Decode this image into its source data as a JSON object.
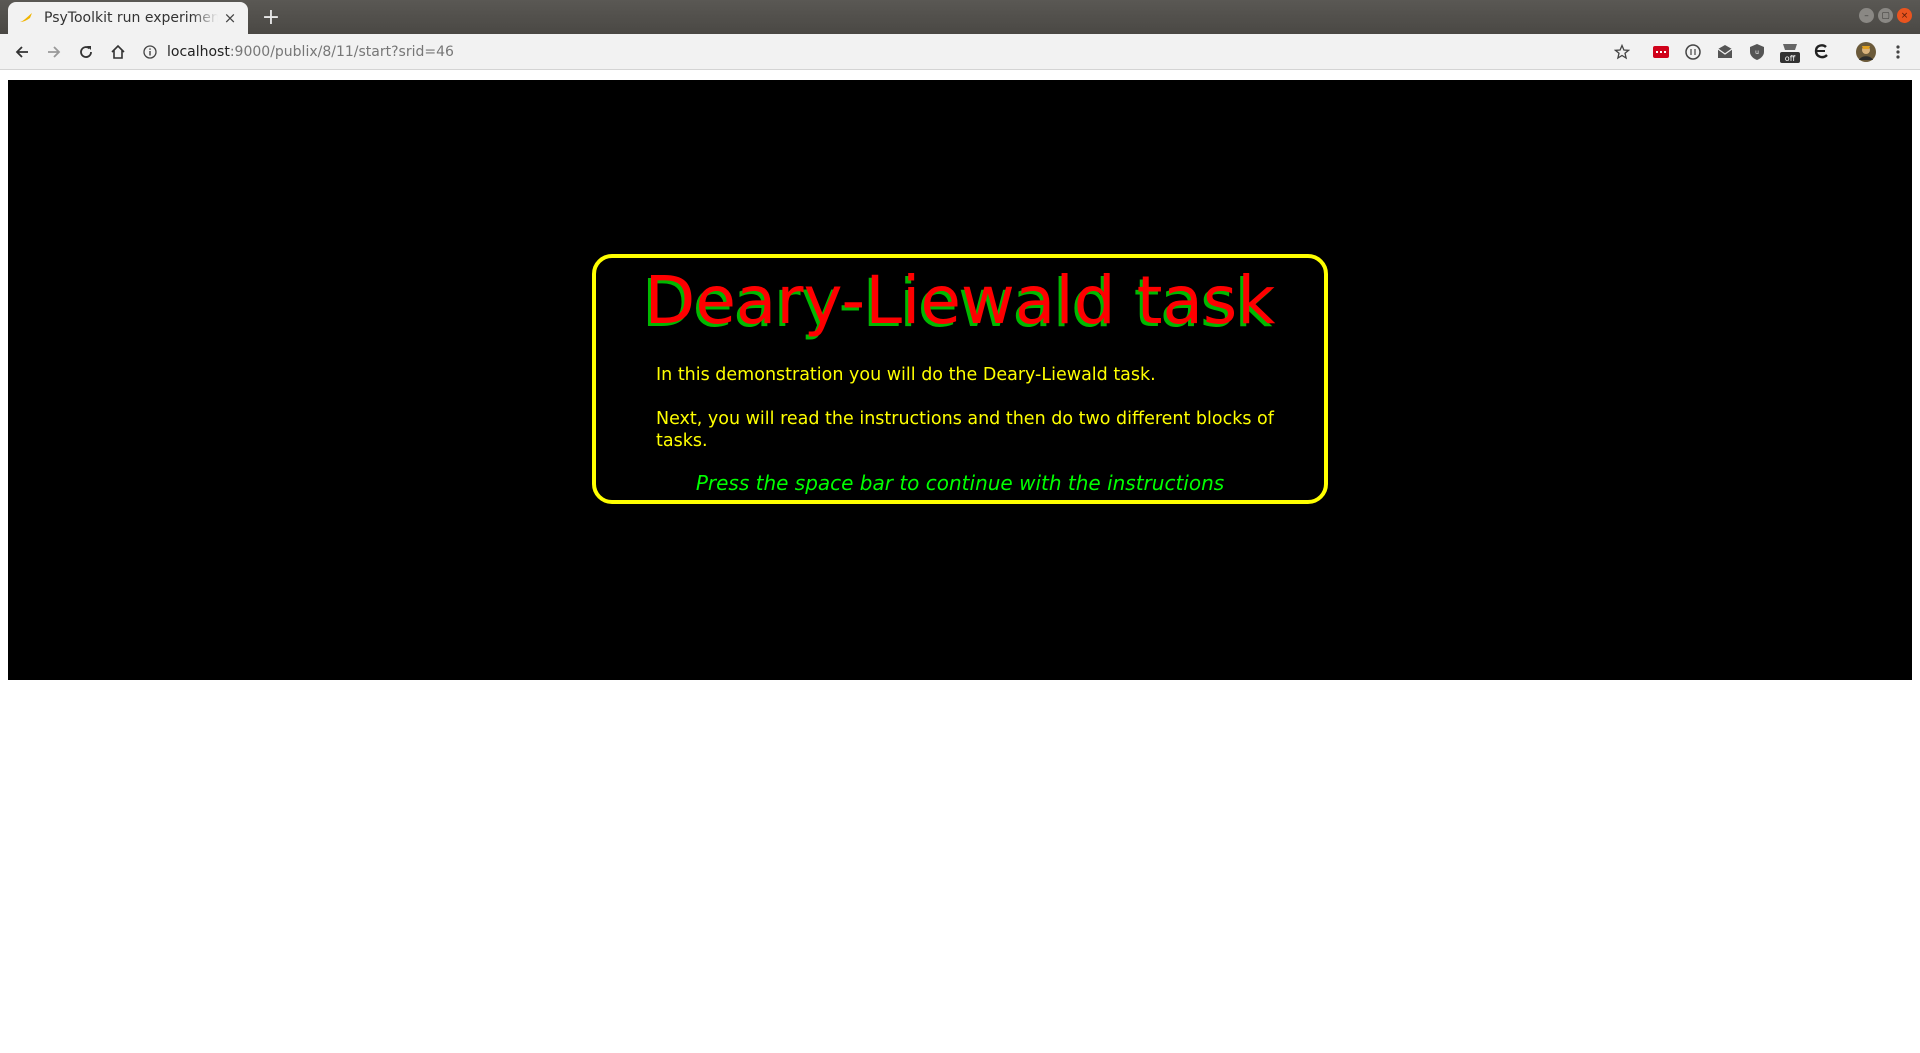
{
  "browser": {
    "tab": {
      "title": "PsyToolkit run experiment",
      "close_glyph": "×"
    },
    "new_tab_glyph": "+",
    "url": {
      "host": "localhost",
      "path": ":9000/publix/8/11/start?srid=46"
    },
    "extensions": [
      "red-extension-icon",
      "circle-extension-icon",
      "mail-extension-icon",
      "shield-extension-icon",
      "off-extension-icon",
      "e-extension-icon",
      "profile-avatar-icon"
    ],
    "window_controls": {
      "minimize": "–",
      "maximize": "▢",
      "close": "×"
    }
  },
  "experiment": {
    "title": "Deary-Liewald task",
    "paragraph1": "In this demonstration you will do the Deary-Liewald task.",
    "paragraph2": "Next, you will read the instructions and then do two different blocks of tasks.",
    "continue_prompt": "Press the space bar to continue with the instructions",
    "colors": {
      "background": "#000000",
      "border": "#ffff00",
      "title": "#ff0000",
      "title_shadow": "#00b800",
      "text": "#ffff00",
      "prompt": "#00ff00"
    }
  }
}
